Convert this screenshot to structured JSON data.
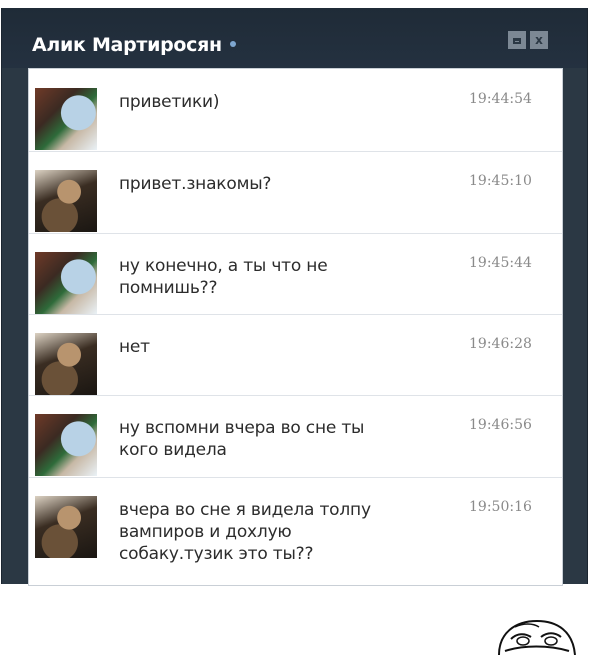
{
  "window": {
    "contact_name": "Алик Мартиросян",
    "buttons": {
      "minimize_icon": "minimize-icon",
      "close_label": "x"
    }
  },
  "messages": [
    {
      "author": "alik",
      "text": "приветики)",
      "time": "19:44:54"
    },
    {
      "author": "girl",
      "text": "привет.знакомы?",
      "time": "19:45:10"
    },
    {
      "author": "alik",
      "text": "ну конечно, а ты что не\nпомнишь??",
      "time": "19:45:44"
    },
    {
      "author": "girl",
      "text": "нет",
      "time": "19:46:28"
    },
    {
      "author": "alik",
      "text": "ну вспомни вчера во сне ты\nкого видела",
      "time": "19:46:56"
    },
    {
      "author": "girl",
      "text": "вчера во сне я видела толпу\nвампиров и дохлую\nсобаку.тузик это ты??",
      "time": "19:50:16"
    }
  ],
  "colors": {
    "titlebar": "#243140",
    "window_frame": "#2b3844",
    "time_text": "#8a8a8a",
    "message_text": "#2c2c2c"
  },
  "decoration": {
    "meme": "trollface-icon"
  }
}
